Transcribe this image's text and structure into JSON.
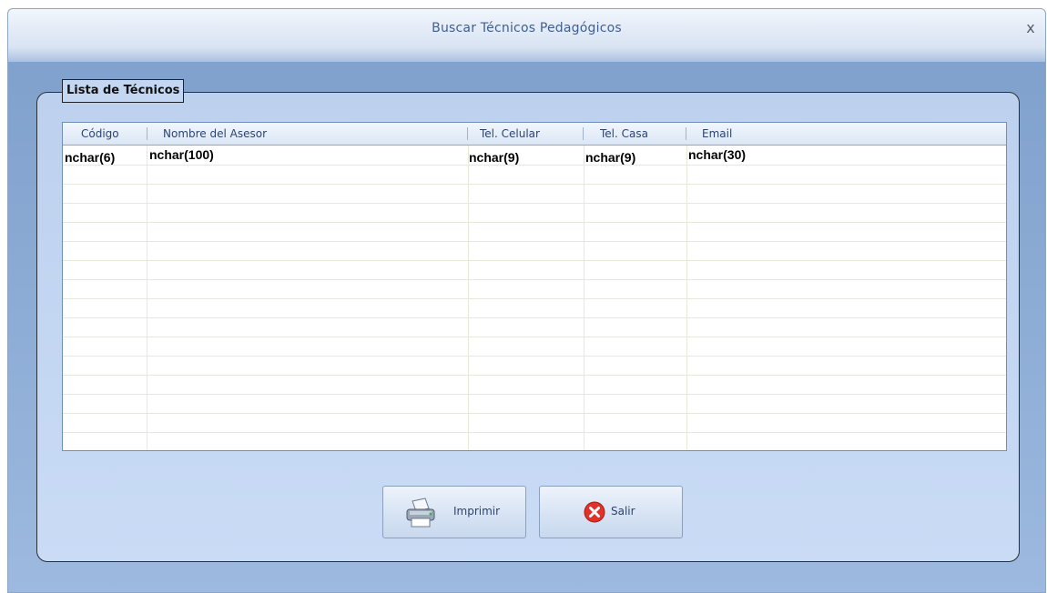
{
  "window": {
    "title": "Buscar Técnicos Pedagógicos",
    "close_glyph": "x"
  },
  "group": {
    "legend": "Lista de Técnicos"
  },
  "table": {
    "columns": [
      "Código",
      "Nombre del Asesor",
      "Tel. Celular",
      "Tel. Casa",
      "Email"
    ],
    "rows": [
      [
        "nchar(6)",
        "nchar(100)",
        "nchar(9)",
        "nchar(9)",
        "nchar(30)"
      ]
    ]
  },
  "buttons": {
    "print": {
      "label": "Imprimir",
      "icon": "printer-icon"
    },
    "exit": {
      "label": "Salir",
      "icon": "error-x-icon"
    }
  },
  "colors": {
    "title_text": "#3f5f93",
    "window_bg": "#89a9d3",
    "group_bg": "#c3d6f2",
    "exit_icon": "#e0312b"
  }
}
